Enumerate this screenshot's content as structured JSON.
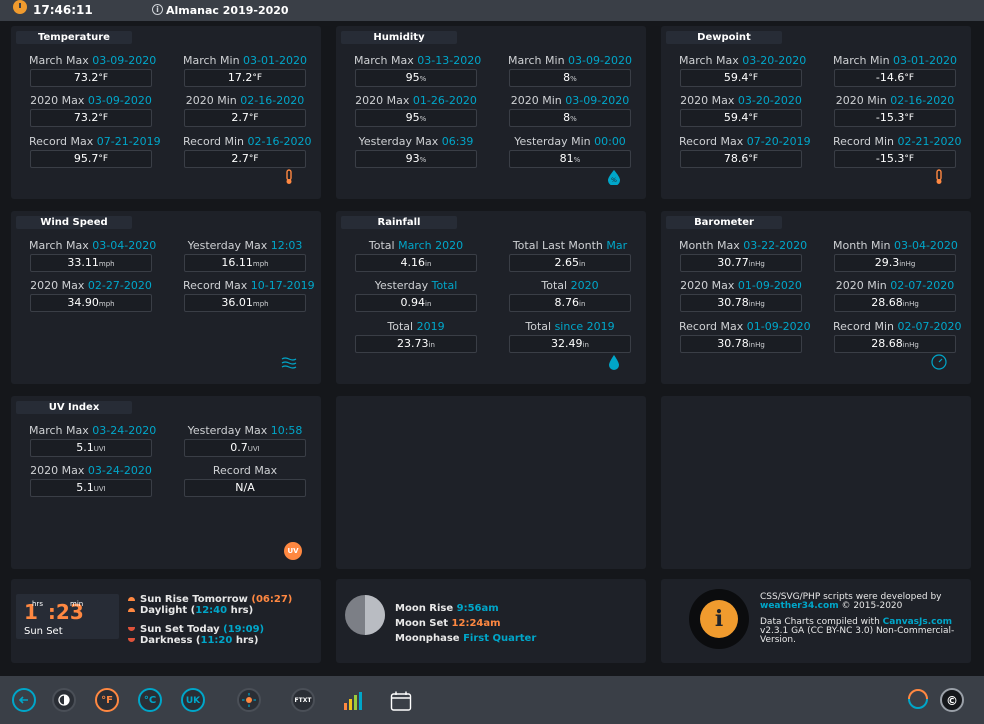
{
  "topbar": {
    "time": "17:46:11",
    "title": "Almanac 2019-2020"
  },
  "temperature": {
    "title": "Temperature",
    "cells": [
      {
        "pre": "March Max",
        "date": "03-09-2020",
        "value": "73.2",
        "unit": "°F"
      },
      {
        "pre": "March Min",
        "date": "03-01-2020",
        "value": "17.2",
        "unit": "°F"
      },
      {
        "pre": "2020 Max",
        "date": "03-09-2020",
        "value": "73.2",
        "unit": "°F"
      },
      {
        "pre": "2020 Min",
        "date": "02-16-2020",
        "value": "2.7",
        "unit": "°F"
      },
      {
        "pre": "Record Max",
        "date": "07-21-2019",
        "value": "95.7",
        "unit": "°F"
      },
      {
        "pre": "Record Min",
        "date": "02-16-2020",
        "value": "2.7",
        "unit": "°F"
      }
    ]
  },
  "humidity": {
    "title": "Humidity",
    "cells": [
      {
        "pre": "March Max",
        "date": "03-13-2020",
        "value": "95",
        "unit": "%"
      },
      {
        "pre": "March Min",
        "date": "03-09-2020",
        "value": "8",
        "unit": "%"
      },
      {
        "pre": "2020 Max",
        "date": "01-26-2020",
        "value": "95",
        "unit": "%"
      },
      {
        "pre": "2020 Min",
        "date": "03-09-2020",
        "value": "8",
        "unit": "%"
      },
      {
        "pre": "Yesterday Max",
        "date": "06:39",
        "value": "93",
        "unit": "%"
      },
      {
        "pre": "Yesterday Min",
        "date": "00:00",
        "value": "81",
        "unit": "%"
      }
    ]
  },
  "dewpoint": {
    "title": "Dewpoint",
    "cells": [
      {
        "pre": "March Max",
        "date": "03-20-2020",
        "value": "59.4",
        "unit": "°F"
      },
      {
        "pre": "March Min",
        "date": "03-01-2020",
        "value": "-14.6",
        "unit": "°F"
      },
      {
        "pre": "2020 Max",
        "date": "03-20-2020",
        "value": "59.4",
        "unit": "°F"
      },
      {
        "pre": "2020 Min",
        "date": "02-16-2020",
        "value": "-15.3",
        "unit": "°F"
      },
      {
        "pre": "Record Max",
        "date": "07-20-2019",
        "value": "78.6",
        "unit": "°F"
      },
      {
        "pre": "Record Min",
        "date": "02-21-2020",
        "value": "-15.3",
        "unit": "°F"
      }
    ]
  },
  "wind": {
    "title": "Wind Speed",
    "cells": [
      {
        "pre": "March Max",
        "date": "03-04-2020",
        "value": "33.11",
        "unit": "mph"
      },
      {
        "pre": "Yesterday Max",
        "date": "12:03",
        "value": "16.11",
        "unit": "mph"
      },
      {
        "pre": "2020 Max",
        "date": "02-27-2020",
        "value": "34.90",
        "unit": "mph"
      },
      {
        "pre": "Record Max",
        "date": "10-17-2019",
        "value": "36.01",
        "unit": "mph"
      }
    ]
  },
  "rainfall": {
    "title": "Rainfall",
    "cells": [
      {
        "pre": "Total",
        "date": "March 2020",
        "value": "4.16",
        "unit": "in"
      },
      {
        "pre": "Total Last Month",
        "date": "Mar",
        "value": "2.65",
        "unit": "in"
      },
      {
        "pre": "Yesterday",
        "date": "Total",
        "value": "0.94",
        "unit": "in"
      },
      {
        "pre": "Total",
        "date": "2020",
        "value": "8.76",
        "unit": "in"
      },
      {
        "pre": "Total",
        "date": "2019",
        "value": "23.73",
        "unit": "in"
      },
      {
        "pre": "Total",
        "date": "since 2019",
        "value": "32.49",
        "unit": "in"
      }
    ]
  },
  "barometer": {
    "title": "Barometer",
    "cells": [
      {
        "pre": "Month Max",
        "date": "03-22-2020",
        "value": "30.77",
        "unit": "inHg"
      },
      {
        "pre": "Month Min",
        "date": "03-04-2020",
        "value": "29.3",
        "unit": "inHg"
      },
      {
        "pre": "2020 Max",
        "date": "01-09-2020",
        "value": "30.78",
        "unit": "inHg"
      },
      {
        "pre": "2020 Min",
        "date": "02-07-2020",
        "value": "28.68",
        "unit": "inHg"
      },
      {
        "pre": "Record Max",
        "date": "01-09-2020",
        "value": "30.78",
        "unit": "inHg"
      },
      {
        "pre": "Record Min",
        "date": "02-07-2020",
        "value": "28.68",
        "unit": "inHg"
      }
    ]
  },
  "uv": {
    "title": "UV Index",
    "icon_label": "UV",
    "cells": [
      {
        "pre": "March Max",
        "date": "03-24-2020",
        "value": "5.1",
        "unit": "UVI"
      },
      {
        "pre": "Yesterday Max",
        "date": "10:58",
        "value": "0.7",
        "unit": "UVI"
      },
      {
        "pre": "2020 Max",
        "date": "03-24-2020",
        "value": "5.1",
        "unit": "UVI"
      },
      {
        "pre": "Record Max",
        "date": "",
        "value": "N/A",
        "unit": ""
      }
    ]
  },
  "sun": {
    "hours": "1",
    "minutes": ":23",
    "hrs_label": "hrs",
    "min_label": "min",
    "caption": "Sun Set",
    "rise_label": "Sun Rise Tomorrow",
    "rise_time": "(06:27)",
    "daylight_label": "Daylight",
    "daylight_open": "(",
    "daylight_value": "12:40",
    "daylight_unit": "hrs)",
    "set_label": "Sun Set Today",
    "set_time": "(19:09)",
    "darkness_label": "Darkness",
    "darkness_open": "(",
    "darkness_value": "11:20",
    "darkness_unit": "hrs)"
  },
  "moon": {
    "rise_label": "Moon Rise",
    "rise_value": "9:56am",
    "set_label": "Moon Set",
    "set_value": "12:24am",
    "phase_label": "Moonphase",
    "phase_value": "First Quarter"
  },
  "credits": {
    "line1": "CSS/SVG/PHP scripts were developed by",
    "link1": "weather34.com",
    "line2": " © 2015-2020",
    "line3": "Data Charts compiled with ",
    "link2": "CanvasJs.com",
    "line4": "v2.3.1 GA (CC BY-NC 3.0) Non-Commercial-",
    "line5": "Version."
  },
  "toolbar": {
    "f_label": "°F",
    "c_label": "°C",
    "uk_label": "UK",
    "txt_label": "FTXT"
  },
  "colors": {
    "accent_cyan": "#00a6c9",
    "accent_orange": "#ff8841",
    "warning_orange": "#f09b2e"
  }
}
